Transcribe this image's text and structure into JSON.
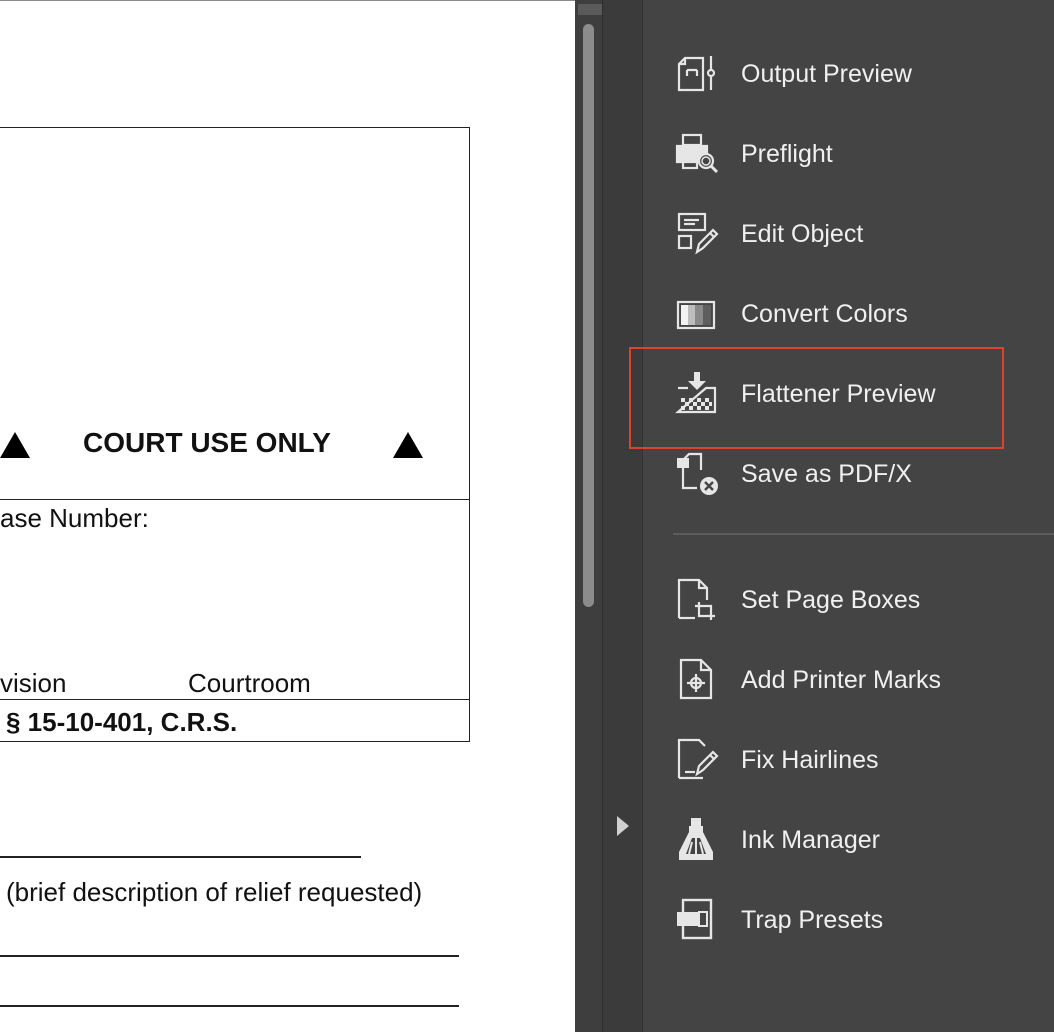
{
  "document": {
    "court_use_only": "COURT USE ONLY",
    "case_number_label": "ase Number:",
    "division_label": "vision",
    "courtroom_label": "Courtroom",
    "statute": "§ 15-10-401, C.R.S.",
    "relief_caption": "(brief description of relief requested)"
  },
  "tools_panel": {
    "group1": [
      {
        "label": "Output Preview",
        "icon": "output-preview-icon"
      },
      {
        "label": "Preflight",
        "icon": "preflight-icon"
      },
      {
        "label": "Edit Object",
        "icon": "edit-object-icon"
      },
      {
        "label": "Convert Colors",
        "icon": "convert-colors-icon"
      },
      {
        "label": "Flattener Preview",
        "icon": "flattener-preview-icon"
      },
      {
        "label": "Save as PDF/X",
        "icon": "save-as-pdfx-icon"
      }
    ],
    "group2": [
      {
        "label": "Set Page Boxes",
        "icon": "set-page-boxes-icon"
      },
      {
        "label": "Add Printer Marks",
        "icon": "add-printer-marks-icon"
      },
      {
        "label": "Fix Hairlines",
        "icon": "fix-hairlines-icon"
      },
      {
        "label": "Ink Manager",
        "icon": "ink-manager-icon"
      },
      {
        "label": "Trap Presets",
        "icon": "trap-presets-icon"
      }
    ]
  },
  "colors": {
    "panel_bg": "#444444",
    "highlight_border": "#d9432f",
    "icon_stroke": "#e6e6e6"
  }
}
